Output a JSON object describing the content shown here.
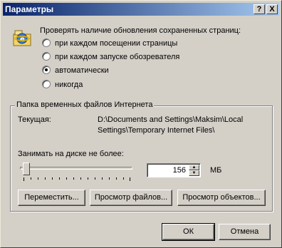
{
  "window": {
    "title": "Параметры"
  },
  "titlebar": {
    "help_glyph": "?",
    "close_glyph": "X"
  },
  "check": {
    "heading": "Проверять наличие обновления сохраненных страниц:",
    "options": [
      {
        "label": "при каждом посещении страницы",
        "selected": false
      },
      {
        "label": "при каждом запуске обозревателя",
        "selected": false
      },
      {
        "label": "автоматически",
        "selected": true
      },
      {
        "label": "никогда",
        "selected": false
      }
    ]
  },
  "temp": {
    "group_label": "Папка временных файлов Интернета",
    "current_label": "Текущая:",
    "path_line1": "D:\\Documents and Settings\\Maksim\\Local",
    "path_line2": "Settings\\Temporary Internet Files\\",
    "disk_label": "Занимать на диске не более:",
    "disk_value": "156",
    "unit": "МБ",
    "move_button": "Переместить...",
    "view_files_button": "Просмотр файлов...",
    "view_objects_button": "Просмотр объектов..."
  },
  "footer": {
    "ok": "ОК",
    "cancel": "Отмена"
  },
  "icons": {
    "options_icon": "ie-settings-icon"
  }
}
